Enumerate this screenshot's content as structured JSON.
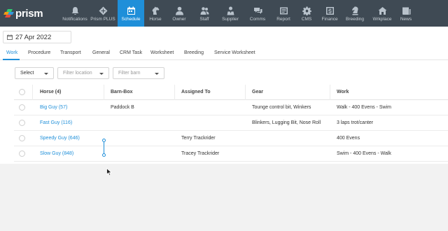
{
  "app": {
    "logo_text": "prism",
    "brand_colors": [
      "#e74c3c",
      "#f39c12",
      "#2ecc71",
      "#3498db"
    ]
  },
  "nav": {
    "items": [
      {
        "label": "Notifications",
        "icon": "bell-icon"
      },
      {
        "label": "Prism PLUS",
        "icon": "plus-icon"
      },
      {
        "label": "Schedule",
        "icon": "calendar-icon",
        "active": true
      },
      {
        "label": "Horse",
        "icon": "horse-icon"
      },
      {
        "label": "Owner",
        "icon": "owner-icon"
      },
      {
        "label": "Staff",
        "icon": "staff-icon"
      },
      {
        "label": "Supplier",
        "icon": "supplier-icon"
      },
      {
        "label": "Comms",
        "icon": "comms-icon"
      },
      {
        "label": "Report",
        "icon": "report-icon"
      },
      {
        "label": "CMS",
        "icon": "gear-icon"
      },
      {
        "label": "Finance",
        "icon": "finance-icon"
      },
      {
        "label": "Breeding",
        "icon": "chess-knight-icon"
      },
      {
        "label": "Wrkplace",
        "icon": "workplace-icon"
      },
      {
        "label": "News",
        "icon": "news-icon"
      }
    ]
  },
  "date_picker": {
    "value": "27 Apr 2022",
    "icon": "calendar-icon"
  },
  "tabs": [
    {
      "label": "Work",
      "active": true
    },
    {
      "label": "Procedure"
    },
    {
      "label": "Transport"
    },
    {
      "label": "General"
    },
    {
      "label": "CRM Task"
    },
    {
      "label": "Worksheet"
    },
    {
      "label": "Breeding"
    },
    {
      "label": "Service Worksheet"
    }
  ],
  "filters": {
    "select": "Select",
    "location_placeholder": "Filter location",
    "barn_placeholder": "Filter barn"
  },
  "table": {
    "columns": [
      "Horse (4)",
      "Barn-Box",
      "Assigned To",
      "Gear",
      "Work"
    ],
    "rows": [
      {
        "horse": "Big Guy (57)",
        "barn": "Paddock B",
        "assigned": "",
        "gear": "Tounge control bit, Winkers",
        "work": "Walk - 400 Evens - Swim"
      },
      {
        "horse": "Fast Guy (116)",
        "barn": "",
        "assigned": "",
        "gear": "Blinkers, Lugging Bit, Nose Roll",
        "work": "3 laps trot/canter"
      },
      {
        "horse": "Speedy Guy (646)",
        "barn": "",
        "assigned": "Terry Trackrider",
        "gear": "",
        "work": "400 Evens"
      },
      {
        "horse": "Slow Guy (848)",
        "barn": "",
        "assigned": "Tracey Trackrider",
        "gear": "",
        "work": "Swim - 400 Evens - Walk"
      }
    ]
  },
  "colors": {
    "accent": "#1f8fd9",
    "nav_bg": "#3f4a54"
  }
}
